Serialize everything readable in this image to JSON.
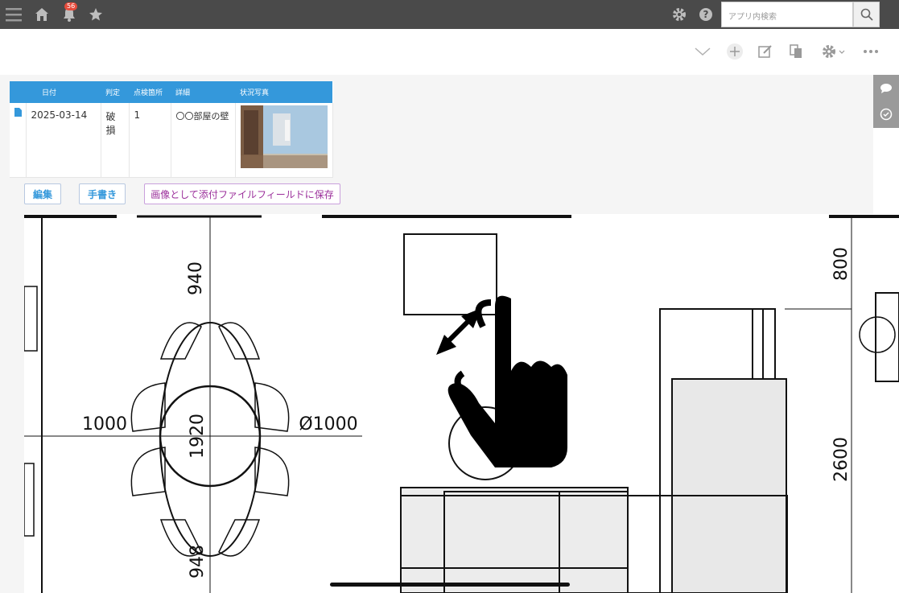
{
  "topbar": {
    "notification_count": "56",
    "search_placeholder": "アプリ内検索",
    "icons": [
      "menu-icon",
      "home-icon",
      "bell-icon",
      "star-icon",
      "gear-icon",
      "help-icon",
      "search-icon"
    ]
  },
  "toolbar": {
    "icons": [
      "chevron-down-icon",
      "plus-icon",
      "edit-icon",
      "copy-icon",
      "gear-icon",
      "more-icon"
    ]
  },
  "record": {
    "table_headers": [
      "日付",
      "判定",
      "点検箇所",
      "詳細",
      "状況写真"
    ],
    "rows": [
      {
        "date": "2025-03-14",
        "judgement": "破損",
        "location": "1",
        "detail": "〇〇部屋の壁"
      }
    ]
  },
  "actions": {
    "edit": "編集",
    "handwriting": "手書き",
    "save_image": "画像として添付ファイルフィールドに保存"
  },
  "drawing": {
    "dimensions": [
      "940",
      "1000",
      "1920",
      "Ø1000",
      "800",
      "2600",
      "948"
    ]
  },
  "colors": {
    "topbar": "#4a4a4a",
    "accent": "#3498db",
    "save_button_text": "#9b2f9b",
    "badge": "#e74c3c"
  }
}
